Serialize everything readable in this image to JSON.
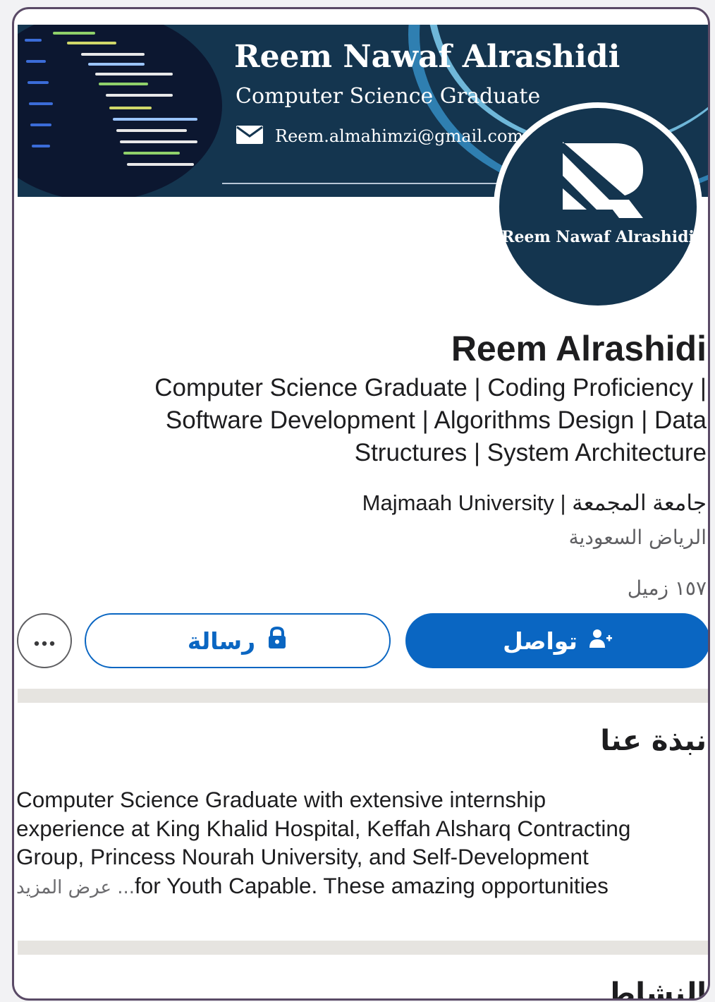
{
  "banner": {
    "name": "Reem Nawaf Alrashidi",
    "subtitle": "Computer Science Graduate",
    "email": "Reem.almahimzi@gmail.com"
  },
  "avatar": {
    "caption": "Reem Nawaf Alrashidi",
    "logo_icon": "r-logo-icon"
  },
  "profile": {
    "name": "Reem Alrashidi",
    "headline_lines": [
      "Computer Science Graduate | Coding Proficiency |",
      "Software Development | Algorithms Design | Data",
      "Structures | System Architecture"
    ],
    "education": "جامعة المجمعة | Majmaah University",
    "location": "الرياض السعودية",
    "connections": "١٥٧ زميل"
  },
  "actions": {
    "connect_label": "تواصل",
    "connect_icon": "add-person-icon",
    "message_label": "رسالة",
    "message_icon": "lock-icon",
    "more_icon": "ellipsis-icon"
  },
  "about": {
    "title": "نبذة عنا",
    "text_lines": [
      "Computer Science Graduate with extensive internship",
      "experience at King Khalid Hospital, Keffah Alsharq Contracting",
      "Group, Princess Nourah University, and Self-Development",
      "for Youth Capable. These amazing opportunities"
    ],
    "see_more": "... عرض المزيد"
  },
  "activity": {
    "title": "النشاط"
  },
  "colors": {
    "brand_blue": "#0a66c2",
    "banner_navy": "#14354f",
    "frame_border": "#5a4a66"
  }
}
